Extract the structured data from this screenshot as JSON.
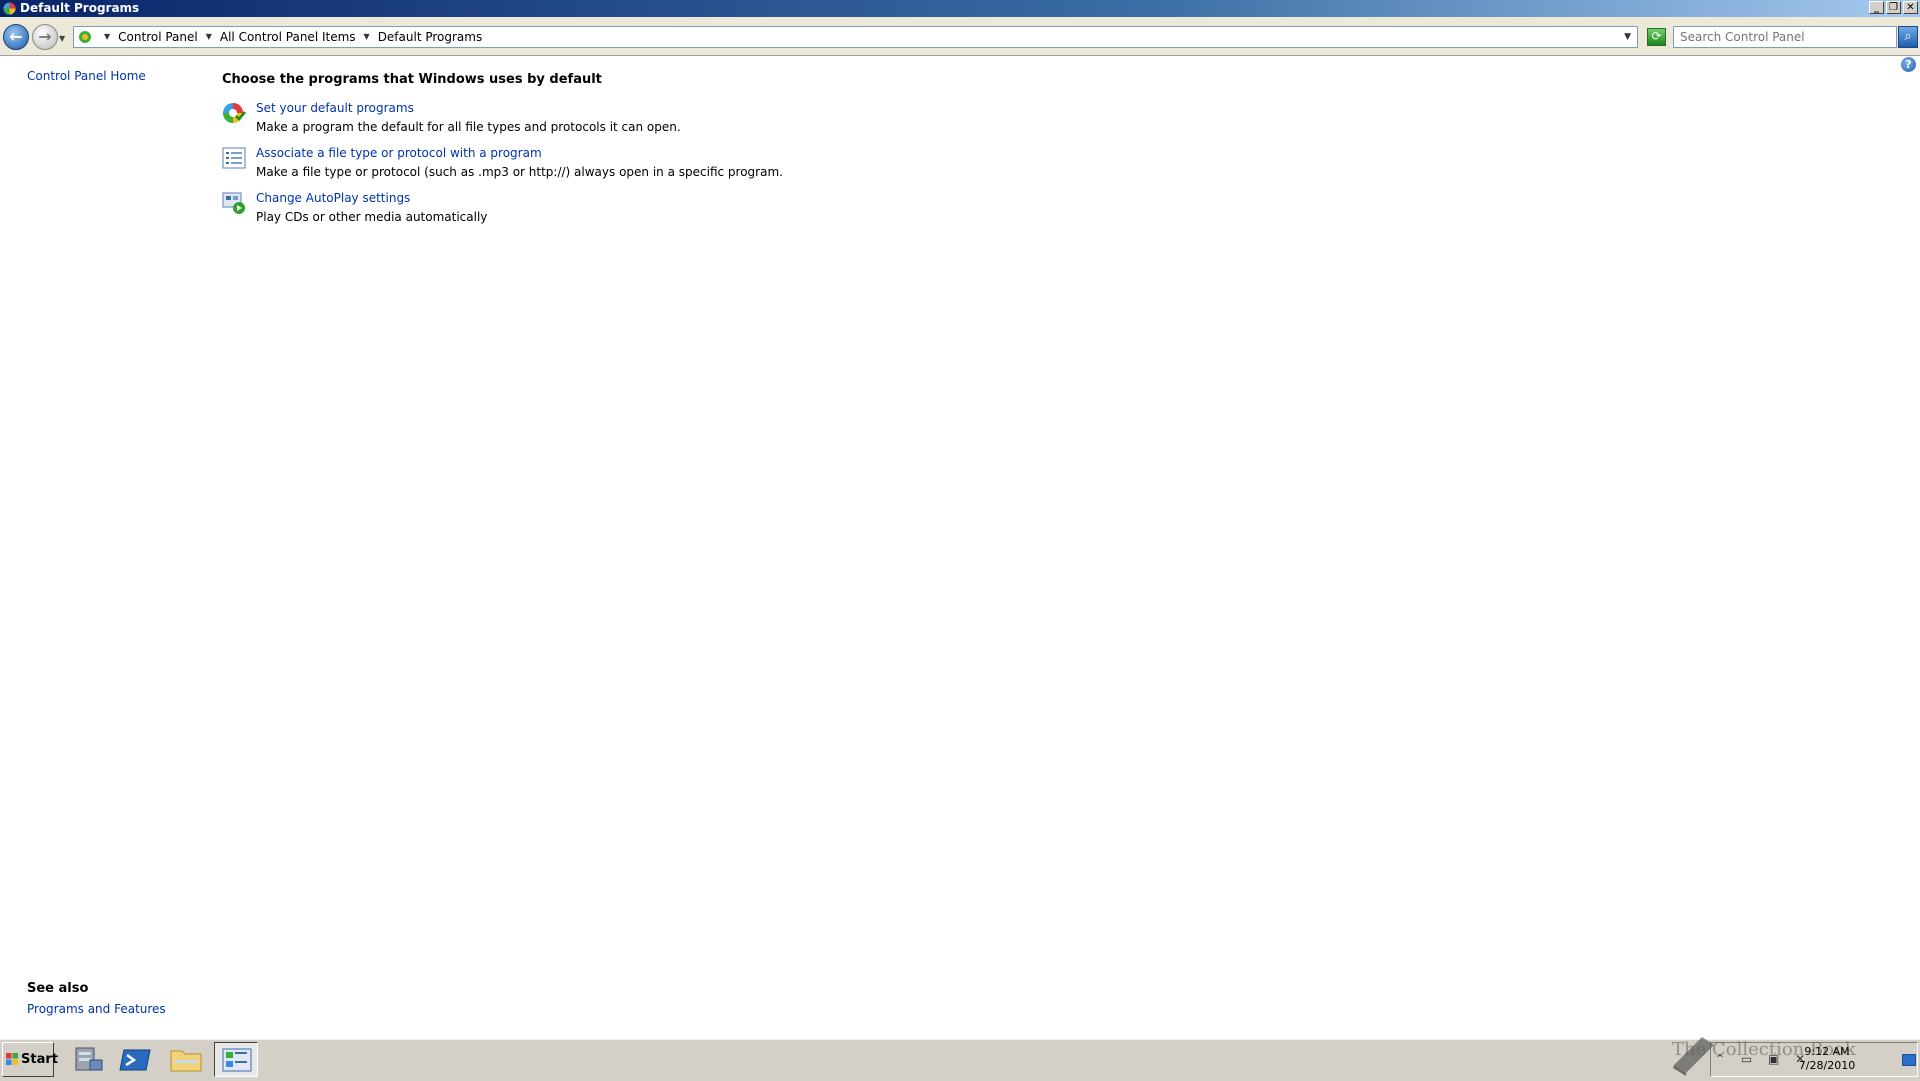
{
  "window": {
    "title": "Default Programs"
  },
  "address_bar": {
    "crumbs": [
      "Control Panel",
      "All Control Panel Items",
      "Default Programs"
    ],
    "search_placeholder": "Search Control Panel"
  },
  "left_pane": {
    "home_link": "Control Panel Home",
    "see_also_title": "See also",
    "see_also_links": [
      "Programs and Features"
    ]
  },
  "main": {
    "heading": "Choose the programs that Windows uses by default",
    "tasks": [
      {
        "link": "Set your default programs",
        "desc": "Make a program the default for all file types and protocols it can open.",
        "icon": "default-programs-icon"
      },
      {
        "link": "Associate a file type or protocol with a program",
        "desc": "Make a file type or protocol (such as .mp3 or http://) always open in a specific program.",
        "icon": "file-association-icon"
      },
      {
        "link": "Change AutoPlay settings",
        "desc": "Play CDs or other media automatically",
        "icon": "autoplay-icon"
      }
    ]
  },
  "taskbar": {
    "start_label": "Start",
    "pinned": [
      "server-manager-icon",
      "powershell-icon",
      "explorer-icon",
      "control-panel-icon"
    ],
    "clock_time": "9:12 AM",
    "clock_date": "7/28/2010",
    "watermark": "The Collection Book"
  },
  "colors": {
    "link": "#0033aa",
    "title_bar": "#0a246a"
  }
}
